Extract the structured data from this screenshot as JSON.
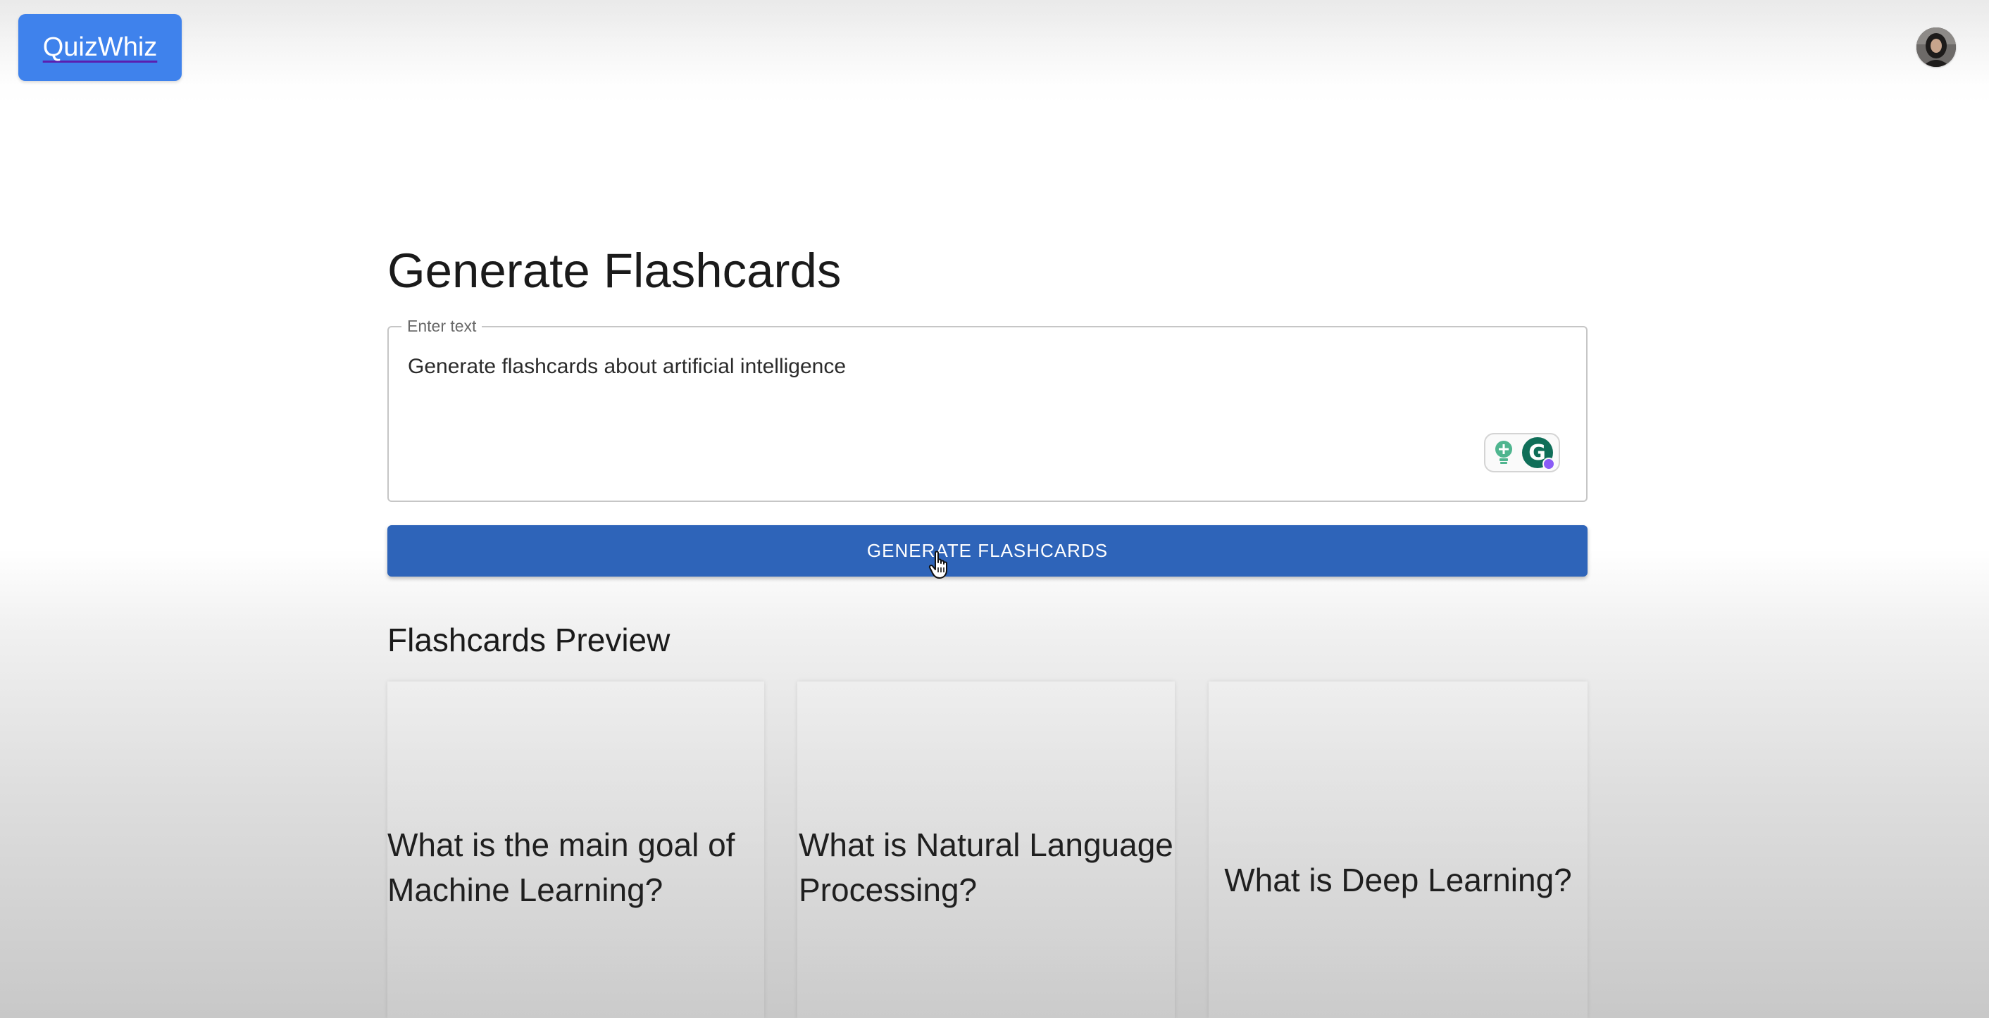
{
  "app": {
    "logo_text": "QuizWhiz"
  },
  "main": {
    "title": "Generate Flashcards",
    "input": {
      "label": "Enter text",
      "value": "Generate flashcards about artificial intelligence"
    },
    "generate_button_label": "GENERATE FLASHCARDS",
    "preview_title": "Flashcards Preview",
    "cards": [
      {
        "front": "What is the main goal of Machine Learning?"
      },
      {
        "front": "What is Natural Language Processing?"
      },
      {
        "front": "What is Deep Learning?"
      }
    ]
  },
  "extension": {
    "grammarly_letter": "G",
    "icons": [
      "lightbulb-icon",
      "grammarly-icon"
    ]
  },
  "colors": {
    "brand": "#3f82ec",
    "primary_button": "#2e64b9",
    "grammarly_green": "#0f6e58",
    "grammarly_dot": "#8a5cf6"
  }
}
